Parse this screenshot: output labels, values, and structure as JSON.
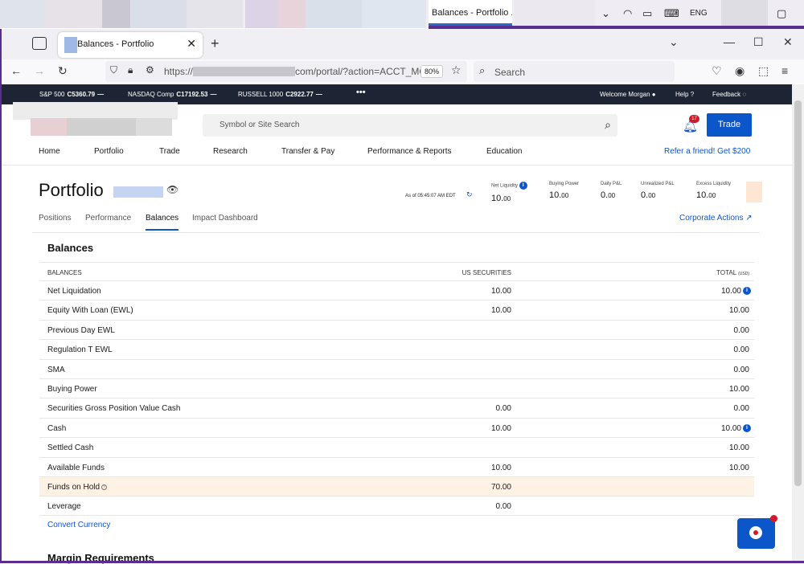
{
  "os": {
    "app_tab_title": "Balances - Portfolio ...",
    "language": "ENG"
  },
  "browser": {
    "tab_title": "Balances - Portfolio",
    "url_prefix": "https://",
    "url_suffix": "com/portal/?action=ACCT_MG",
    "zoom": "80%",
    "search_placeholder": "Search"
  },
  "ticker": {
    "items": [
      {
        "name": "S&P 500",
        "value": "C5360.79",
        "change": "—"
      },
      {
        "name": "NASDAQ Comp",
        "value": "C17192.53",
        "change": "—"
      },
      {
        "name": "RUSSELL 1000",
        "value": "C2922.77",
        "change": "—"
      }
    ],
    "more": "•••",
    "welcome": "Welcome Morgan",
    "help": "Help",
    "feedback": "Feedback"
  },
  "header": {
    "search_placeholder": "Symbol or Site Search",
    "notification_count": "17",
    "trade_label": "Trade",
    "nav": [
      "Home",
      "Portfolio",
      "Trade",
      "Research",
      "Transfer & Pay",
      "Performance & Reports",
      "Education"
    ],
    "refer": "Refer a friend! Get $200"
  },
  "portfolio": {
    "title": "Portfolio",
    "as_of": "As of 05:45:07 AM EDT",
    "metrics": [
      {
        "label": "Net Liquidity",
        "value": "10.",
        "cents": "00",
        "info": true
      },
      {
        "label": "Buying Power",
        "value": "10.",
        "cents": "00",
        "info": false
      },
      {
        "label": "Daily P&L",
        "value": "0.",
        "cents": "00",
        "info": false
      },
      {
        "label": "Unrealized P&L",
        "value": "0.",
        "cents": "00",
        "info": false
      },
      {
        "label": "Excess Liquidity",
        "value": "10.",
        "cents": "00",
        "info": false
      }
    ],
    "tabs": [
      "Positions",
      "Performance",
      "Balances",
      "Impact Dashboard"
    ],
    "active_tab": "Balances",
    "corporate_actions": "Corporate Actions"
  },
  "balances": {
    "section_title": "Balances",
    "columns": {
      "c1": "BALANCES",
      "c2": "US SECURITIES",
      "c3": "TOTAL",
      "c3_unit": "(USD)"
    },
    "rows": [
      {
        "label": "Net Liquidation",
        "us": "10.00",
        "total": "10.00",
        "info": true
      },
      {
        "label": "Equity With Loan (EWL)",
        "us": "10.00",
        "total": "10.00"
      },
      {
        "label": "Previous Day EWL",
        "us": "",
        "total": "0.00"
      },
      {
        "label": "Regulation T EWL",
        "us": "",
        "total": "0.00"
      },
      {
        "label": "SMA",
        "us": "",
        "total": "0.00"
      },
      {
        "label": "Buying Power",
        "us": "",
        "total": "10.00"
      },
      {
        "label": "Securities Gross Position Value Cash",
        "us": "0.00",
        "total": "0.00"
      },
      {
        "label": "Cash",
        "us": "10.00",
        "total": "10.00",
        "info": true
      },
      {
        "label": "Settled Cash",
        "us": "",
        "total": "10.00"
      },
      {
        "label": "Available Funds",
        "us": "10.00",
        "total": "10.00"
      },
      {
        "label": "Funds on Hold",
        "us": "70.00",
        "total": "",
        "highlight": true,
        "help": true
      },
      {
        "label": "Leverage",
        "us": "0.00",
        "total": ""
      }
    ],
    "convert_currency": "Convert Currency",
    "margin_title": "Margin Requirements"
  },
  "colors": {
    "accent": "#0b57c9",
    "ticker_bg": "#1d2433",
    "highlight_row": "#fdf2e3",
    "badge": "#d11a2a"
  }
}
